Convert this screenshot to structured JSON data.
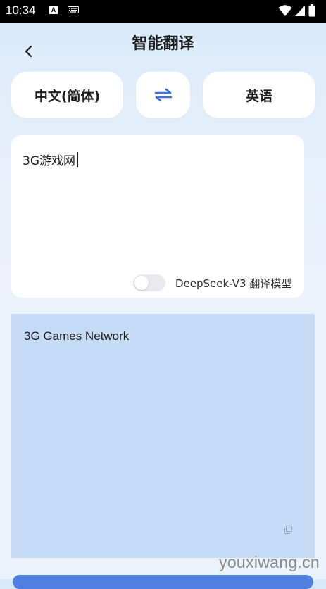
{
  "status_bar": {
    "time": "10:34",
    "notification_icon_letter": "A",
    "icons": [
      "a-notification-icon",
      "keyboard-icon",
      "wifi-icon",
      "signal-icon",
      "battery-icon"
    ]
  },
  "header": {
    "title": "智能翻译",
    "back_icon": "chevron-left-icon"
  },
  "languages": {
    "source": "中文(简体)",
    "target": "英语",
    "swap_icon": "swap-arrows-icon"
  },
  "input": {
    "text": "3G游戏网",
    "model_toggle_on": false,
    "model_label": "DeepSeek-V3 翻译模型"
  },
  "output": {
    "text": "3G Games Network",
    "copy_icon": "copy-icon"
  },
  "watermark": "youxiwang.cn",
  "colors": {
    "accent": "#3c6fe0",
    "output_bg": "#c6dbf6",
    "card_bg": "#ffffff",
    "bottom_button": "#4f7fe0"
  }
}
